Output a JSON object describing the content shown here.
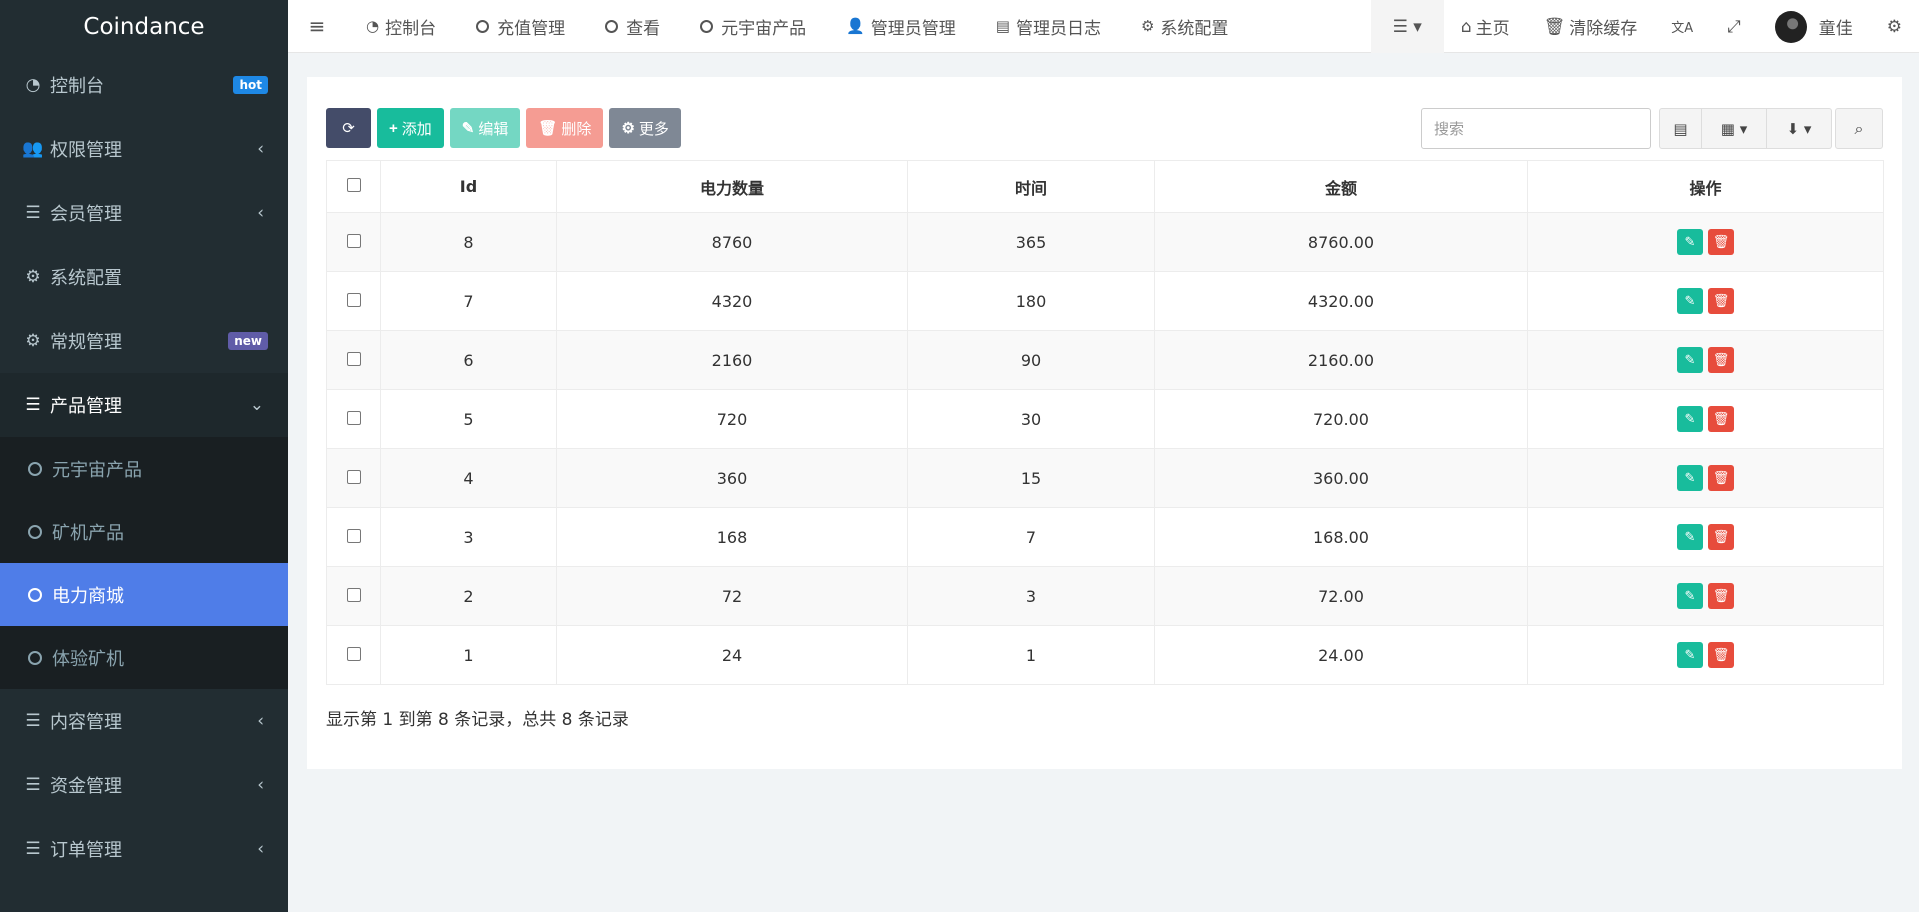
{
  "app": {
    "logo": "Coindance"
  },
  "sidebar": {
    "items": [
      {
        "label": "控制台",
        "icon": "dashboard-icon",
        "badge": "hot"
      },
      {
        "label": "权限管理",
        "icon": "users-icon",
        "arrow": "‹"
      },
      {
        "label": "会员管理",
        "icon": "list-icon",
        "arrow": "‹"
      },
      {
        "label": "系统配置",
        "icon": "gear-icon"
      },
      {
        "label": "常规管理",
        "icon": "cogs-icon",
        "badge": "new"
      },
      {
        "label": "产品管理",
        "icon": "list-icon",
        "arrow": "⌄"
      },
      {
        "label": "内容管理",
        "icon": "list-icon",
        "arrow": "‹"
      },
      {
        "label": "资金管理",
        "icon": "list-icon",
        "arrow": "‹"
      },
      {
        "label": "订单管理",
        "icon": "list-icon",
        "arrow": "‹"
      }
    ],
    "submenu": [
      "元宇宙产品",
      "矿机产品",
      "电力商城",
      "体验矿机"
    ]
  },
  "topnav": {
    "tabs": [
      "控制台",
      "充值管理",
      "查看",
      "元宇宙产品",
      "管理员管理",
      "管理员日志",
      "系统配置"
    ],
    "right": {
      "home": "主页",
      "clear_cache": "清除缓存",
      "user": "童佳"
    }
  },
  "toolbar": {
    "add": "添加",
    "edit": "编辑",
    "delete": "删除",
    "more": "更多"
  },
  "search": {
    "placeholder": "搜索"
  },
  "table": {
    "headers": [
      "Id",
      "电力数量",
      "时间",
      "金额",
      "操作"
    ],
    "rows": [
      [
        "8",
        "8760",
        "365",
        "8760.00"
      ],
      [
        "7",
        "4320",
        "180",
        "4320.00"
      ],
      [
        "6",
        "2160",
        "90",
        "2160.00"
      ],
      [
        "5",
        "720",
        "30",
        "720.00"
      ],
      [
        "4",
        "360",
        "15",
        "360.00"
      ],
      [
        "3",
        "168",
        "7",
        "168.00"
      ],
      [
        "2",
        "72",
        "3",
        "72.00"
      ],
      [
        "1",
        "24",
        "1",
        "24.00"
      ]
    ]
  },
  "pagination": {
    "summary": "显示第 1 到第 8 条记录，总共 8 条记录"
  }
}
